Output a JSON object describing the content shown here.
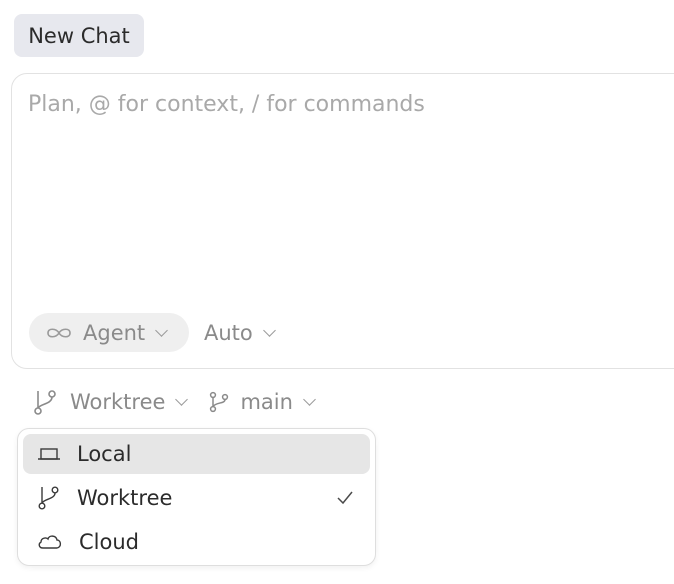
{
  "tab": {
    "label": "New Chat"
  },
  "composer": {
    "placeholder": "Plan, @ for context, / for commands",
    "mode": {
      "label": "Agent",
      "icon": "infinity-icon"
    },
    "model": {
      "label": "Auto"
    }
  },
  "bottom_bar": {
    "environment": {
      "label": "Worktree",
      "icon": "git-fork-icon"
    },
    "branch": {
      "label": "main",
      "icon": "git-branch-icon"
    }
  },
  "environment_menu": {
    "items": [
      {
        "label": "Local",
        "icon": "laptop-icon",
        "checked": false,
        "highlighted": true
      },
      {
        "label": "Worktree",
        "icon": "git-fork-icon",
        "checked": true,
        "highlighted": false
      },
      {
        "label": "Cloud",
        "icon": "cloud-icon",
        "checked": false,
        "highlighted": false
      }
    ]
  },
  "colors": {
    "tab_bg": "#e7e8ee",
    "pill_bg": "#efefef",
    "hover_bg": "#e6e6e6",
    "muted_text": "#8a8a8a",
    "placeholder_text": "#a9a9a9"
  }
}
